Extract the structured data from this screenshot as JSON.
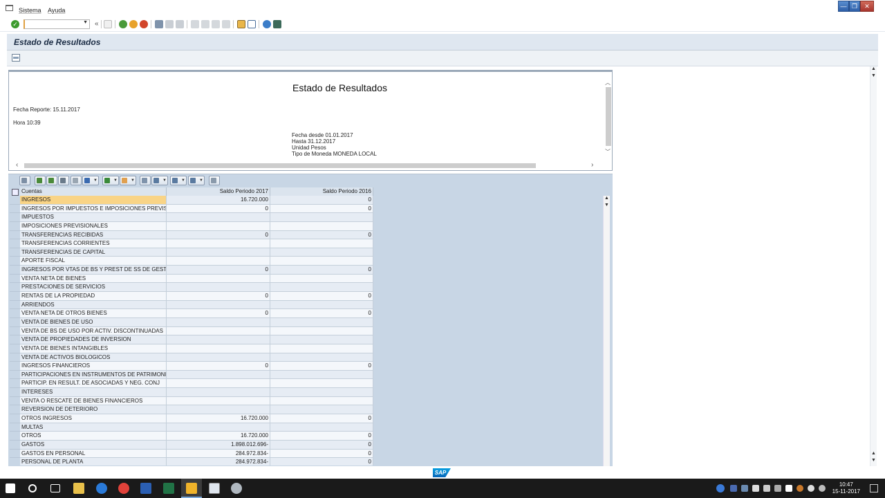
{
  "menu": {
    "items": [
      "Sistema",
      "Ayuda"
    ]
  },
  "window_controls": {
    "minimize": "—",
    "restore": "❐",
    "close": "✕"
  },
  "toolbar": {
    "command_field_value": ""
  },
  "screen_title": "Estado de Resultados",
  "report_header": {
    "title": "Estado de Resultados",
    "fecha_reporte": "Fecha Reporte: 15.11.2017",
    "hora": "Hora 10:39",
    "fecha_desde": "Fecha desde 01.01.2017",
    "hasta": "Hasta 31.12.2017",
    "unidad": "Unidad Pesos",
    "tipo_moneda": "Tipo de Moneda MONEDA LOCAL"
  },
  "table": {
    "columns": [
      "Cuentas",
      "Saldo Periodo 2017",
      "Saldo Periodo 2016"
    ],
    "rows": [
      [
        "INGRESOS",
        "16.720.000",
        "0"
      ],
      [
        "INGRESOS POR IMPUESTOS E IMPOSICIONES PREVIS.",
        "0",
        "0"
      ],
      [
        "IMPUESTOS",
        "",
        ""
      ],
      [
        "IMPOSICIONES PREVISIONALES",
        "",
        ""
      ],
      [
        "TRANSFERENCIAS RECIBIDAS",
        "0",
        "0"
      ],
      [
        "TRANSFERENCIAS CORRIENTES",
        "",
        ""
      ],
      [
        "TRANSFERENCIAS DE CAPITAL",
        "",
        ""
      ],
      [
        "APORTE FISCAL",
        "",
        ""
      ],
      [
        "INGRESOS POR VTAS DE BS Y PREST DE SS DE GEST",
        "0",
        "0"
      ],
      [
        "VENTA NETA DE BIENES",
        "",
        ""
      ],
      [
        "PRESTACIONES DE SERVICIOS",
        "",
        ""
      ],
      [
        "RENTAS DE LA PROPIEDAD",
        "0",
        "0"
      ],
      [
        "ARRIENDOS",
        "",
        ""
      ],
      [
        "VENTA NETA DE OTROS BIENES",
        "0",
        "0"
      ],
      [
        "VENTA DE BIENES DE USO",
        "",
        ""
      ],
      [
        "VENTA DE BS DE USO POR ACTIV. DISCONTINUADAS",
        "",
        ""
      ],
      [
        "VENTA DE PROPIEDADES DE INVERSION",
        "",
        ""
      ],
      [
        "VENTA DE BIENES INTANGIBLES",
        "",
        ""
      ],
      [
        "VENTA DE ACTIVOS BIOLOGICOS",
        "",
        ""
      ],
      [
        "INGRESOS FINANCIEROS",
        "0",
        "0"
      ],
      [
        "PARTICIPACIONES EN INSTRUMENTOS DE PATRIMONIO",
        "",
        ""
      ],
      [
        "PARTICIP. EN RESULT. DE ASOCIADAS Y NEG. CONJ",
        "",
        ""
      ],
      [
        "INTERESES",
        "",
        ""
      ],
      [
        "VENTA O RESCATE DE BIENES FINANCIEROS",
        "",
        ""
      ],
      [
        "REVERSION DE DETERIORO",
        "",
        ""
      ],
      [
        "OTROS INGRESOS",
        "16.720.000",
        "0"
      ],
      [
        "MULTAS",
        "",
        ""
      ],
      [
        "OTROS",
        "16.720.000",
        "0"
      ],
      [
        "GASTOS",
        "1.898.012.696-",
        "0"
      ],
      [
        "GASTOS EN PERSONAL",
        "284.972.834-",
        "0"
      ],
      [
        "PERSONAL DE PLANTA",
        "284.972.834-",
        "0"
      ]
    ]
  },
  "status": {
    "logo": "SAP"
  },
  "taskbar": {
    "time": "10:47",
    "date": "15-11-2017"
  },
  "colors": {
    "title_bg": "#dfe7f0",
    "grid_bg": "#c8d6e5",
    "highlight": "#f9d486"
  }
}
